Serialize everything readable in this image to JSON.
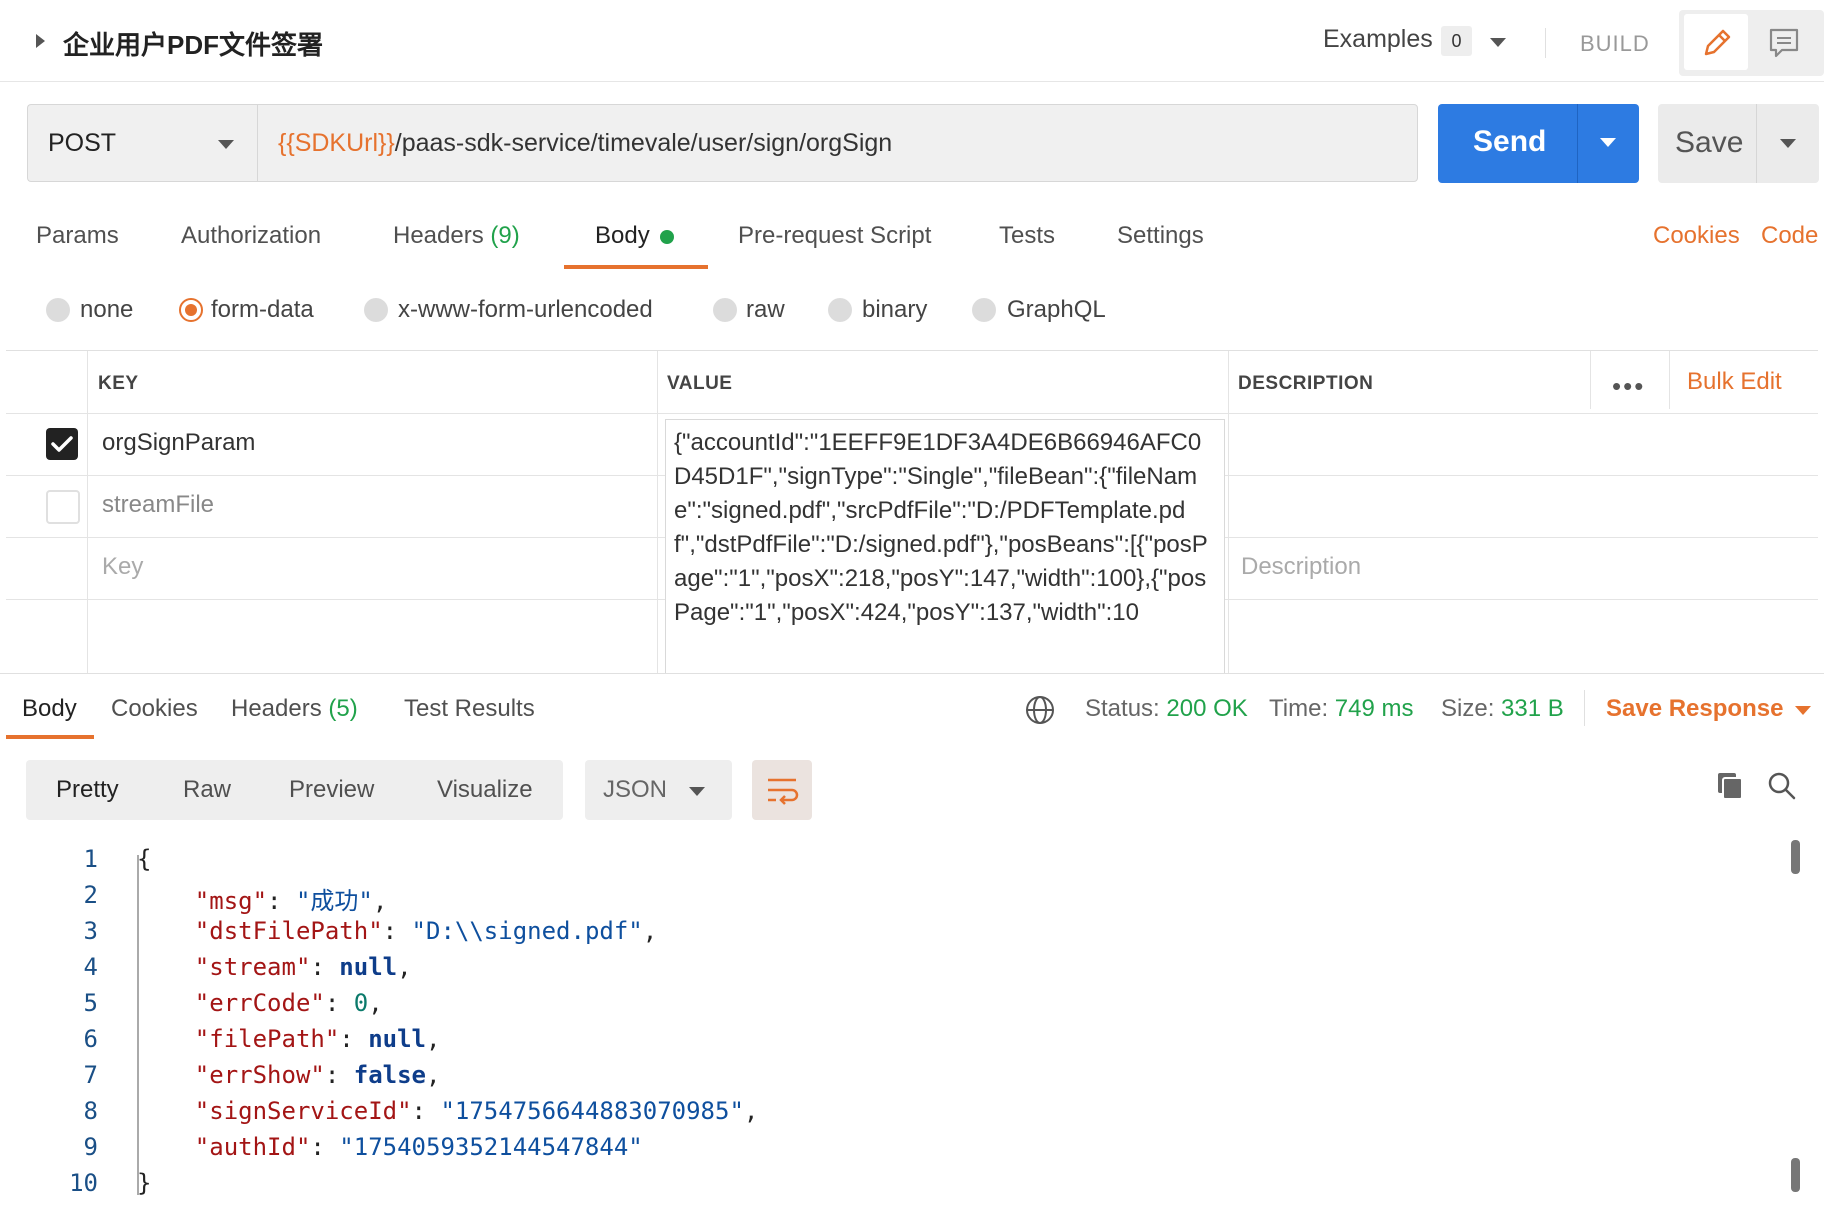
{
  "header": {
    "title": "企业用户PDF文件签署",
    "examples_label": "Examples",
    "examples_count": "0",
    "build_label": "BUILD"
  },
  "request": {
    "method": "POST",
    "url_variable": "{{SDKUrl}}",
    "url_path": "/paas-sdk-service/timevale/user/sign/orgSign",
    "send_label": "Send",
    "save_label": "Save"
  },
  "request_tabs": {
    "params": "Params",
    "authorization": "Authorization",
    "headers": "Headers",
    "headers_count": "(9)",
    "body": "Body",
    "pre_request": "Pre-request Script",
    "tests": "Tests",
    "settings": "Settings",
    "cookies": "Cookies",
    "code": "Code"
  },
  "body_types": [
    "none",
    "form-data",
    "x-www-form-urlencoded",
    "raw",
    "binary",
    "GraphQL"
  ],
  "body_type_selected": "form-data",
  "params_table": {
    "headers": {
      "key": "KEY",
      "value": "VALUE",
      "description": "DESCRIPTION"
    },
    "more": "•••",
    "bulk_edit": "Bulk Edit",
    "rows": [
      {
        "checked": true,
        "key": "orgSignParam",
        "value": "{\"accountId\":\"1EEFF9E1DF3A4DE6B66946AFC0D45D1F\",\"signType\":\"Single\",\"fileBean\":{\"fileName\":\"signed.pdf\",\"srcPdfFile\":\"D:/PDFTemplate.pdf\",\"dstPdfFile\":\"D:/signed.pdf\"},\"posBeans\":[{\"posPage\":\"1\",\"posX\":218,\"posY\":147,\"width\":100},{\"posPage\":\"1\",\"posX\":424,\"posY\":137,\"width\":10"
      },
      {
        "checked": false,
        "key": "streamFile"
      }
    ],
    "key_placeholder": "Key",
    "description_placeholder": "Description"
  },
  "response": {
    "tabs": {
      "body": "Body",
      "cookies": "Cookies",
      "headers": "Headers",
      "headers_count": "(5)",
      "test_results": "Test Results"
    },
    "status_label": "Status:",
    "status_value": "200 OK",
    "time_label": "Time:",
    "time_value": "749 ms",
    "size_label": "Size:",
    "size_value": "331 B",
    "save_response": "Save Response",
    "view_modes": [
      "Pretty",
      "Raw",
      "Preview",
      "Visualize"
    ],
    "format": "JSON"
  },
  "response_body": {
    "line_numbers": [
      "1",
      "2",
      "3",
      "4",
      "5",
      "6",
      "7",
      "8",
      "9",
      "10"
    ],
    "open_brace": "{",
    "close_brace": "}",
    "fields": [
      {
        "key": "\"msg\"",
        "value": "\"成功\"",
        "type": "string"
      },
      {
        "key": "\"dstFilePath\"",
        "value": "\"D:\\\\signed.pdf\"",
        "type": "string"
      },
      {
        "key": "\"stream\"",
        "value": "null",
        "type": "keyword"
      },
      {
        "key": "\"errCode\"",
        "value": "0",
        "type": "number"
      },
      {
        "key": "\"filePath\"",
        "value": "null",
        "type": "keyword"
      },
      {
        "key": "\"errShow\"",
        "value": "false",
        "type": "keyword"
      },
      {
        "key": "\"signServiceId\"",
        "value": "\"1754756644883070985\"",
        "type": "string"
      },
      {
        "key": "\"authId\"",
        "value": "\"1754059352144547844\"",
        "type": "string"
      }
    ]
  },
  "colors": {
    "accent": "#e6722e",
    "primary": "#2d7be2",
    "success": "#21a24b"
  },
  "icons": [
    "expand-caret-icon",
    "pencil-icon",
    "comment-icon",
    "dropdown-caret-icon",
    "globe-icon",
    "copy-icon",
    "search-icon",
    "wrap-lines-icon",
    "checkbox-checked-icon"
  ]
}
